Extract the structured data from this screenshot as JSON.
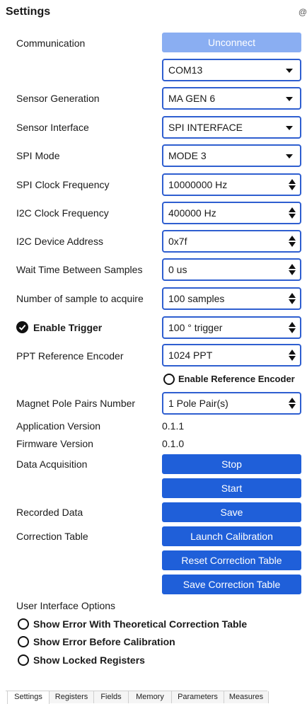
{
  "header": {
    "title": "Settings",
    "corner_glyph": "@"
  },
  "communication": {
    "label": "Communication",
    "button": "Unconnect",
    "port": "COM13"
  },
  "sensor_generation": {
    "label": "Sensor Generation",
    "value": "MA GEN 6"
  },
  "sensor_interface": {
    "label": "Sensor Interface",
    "value": "SPI INTERFACE"
  },
  "spi_mode": {
    "label": "SPI Mode",
    "value": "MODE 3"
  },
  "spi_clock": {
    "label": "SPI Clock Frequency",
    "value": "10000000 Hz"
  },
  "i2c_clock": {
    "label": "I2C Clock Frequency",
    "value": "400000 Hz"
  },
  "i2c_address": {
    "label": "I2C Device Address",
    "value": "0x7f"
  },
  "wait_time": {
    "label": "Wait Time Between Samples",
    "value": "0 us"
  },
  "num_samples": {
    "label": "Number of sample to acquire",
    "value": "100 samples"
  },
  "trigger": {
    "label": "Enable Trigger",
    "checked": true,
    "value": "100 ° trigger"
  },
  "ppt": {
    "label": "PPT Reference Encoder",
    "value": "1024 PPT"
  },
  "reference_encoder": {
    "label": "Enable Reference Encoder",
    "checked": false
  },
  "pole_pairs": {
    "label": "Magnet Pole Pairs Number",
    "value": "1 Pole Pair(s)"
  },
  "app_version": {
    "label": "Application Version",
    "value": "0.1.1"
  },
  "fw_version": {
    "label": "Firmware Version",
    "value": "0.1.0"
  },
  "data_acquisition": {
    "label": "Data Acquisition",
    "stop": "Stop",
    "start": "Start"
  },
  "recorded_data": {
    "label": "Recorded Data",
    "save": "Save"
  },
  "correction_table": {
    "label": "Correction Table",
    "launch": "Launch Calibration",
    "reset": "Reset Correction Table",
    "save": "Save Correction Table"
  },
  "ui_options": {
    "label": "User Interface Options",
    "items": [
      {
        "label": "Show Error With Theoretical Correction Table",
        "checked": false
      },
      {
        "label": "Show Error Before Calibration",
        "checked": false
      },
      {
        "label": "Show Locked Registers",
        "checked": false
      }
    ]
  },
  "tabs": [
    "Settings",
    "Registers",
    "Fields",
    "Memory",
    "Parameters",
    "Measures"
  ],
  "colors": {
    "accent": "#1f5fd9",
    "accent_disabled": "#8aaef2",
    "field_border": "#2f5fd0"
  }
}
